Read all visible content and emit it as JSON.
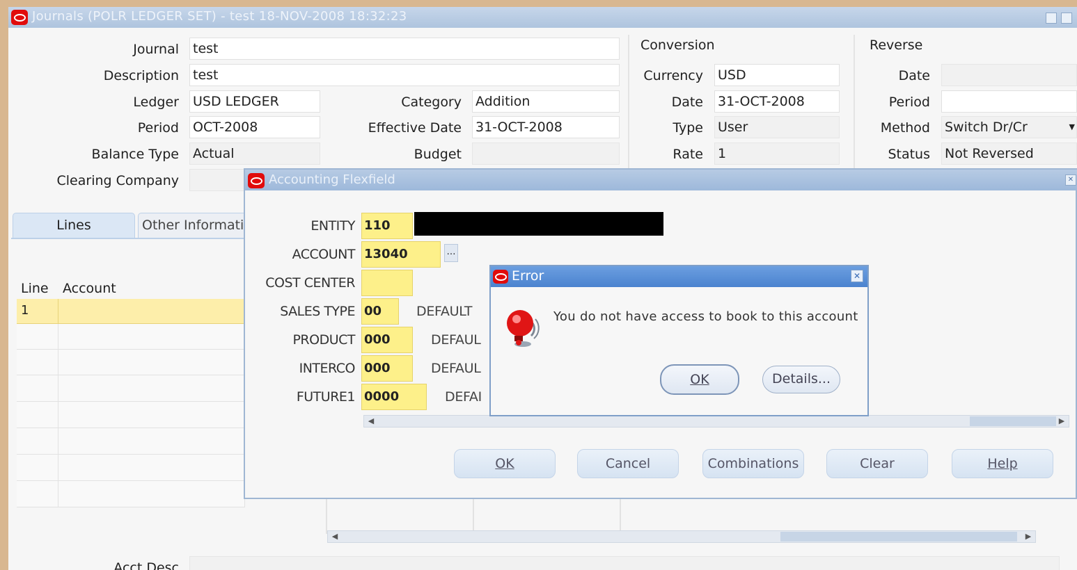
{
  "window": {
    "title": "Journals (POLR LEDGER SET) - test 18-NOV-2008 18:32:23"
  },
  "header": {
    "journal_label": "Journal",
    "journal_value": "test",
    "description_label": "Description",
    "description_value": "test",
    "ledger_label": "Ledger",
    "ledger_value": "USD LEDGER",
    "period_label": "Period",
    "period_value": "OCT-2008",
    "balance_type_label": "Balance Type",
    "balance_type_value": "Actual",
    "clearing_company_label": "Clearing Company",
    "category_label": "Category",
    "category_value": "Addition",
    "effective_date_label": "Effective Date",
    "effective_date_value": "31-OCT-2008",
    "budget_label": "Budget"
  },
  "conversion": {
    "group_label": "Conversion",
    "currency_label": "Currency",
    "currency_value": "USD",
    "date_label": "Date",
    "date_value": "31-OCT-2008",
    "type_label": "Type",
    "type_value": "User",
    "rate_label": "Rate",
    "rate_value": "1"
  },
  "reverse": {
    "group_label": "Reverse",
    "date_label": "Date",
    "period_label": "Period",
    "method_label": "Method",
    "method_value": "Switch Dr/Cr",
    "status_label": "Status",
    "status_value": "Not Reversed"
  },
  "tabs": {
    "lines": "Lines",
    "other": "Other Informatio"
  },
  "lines_grid": {
    "col_line": "Line",
    "col_account": "Account",
    "first_line_value": "1",
    "acct_desc_label": "Acct Desc"
  },
  "flexfield": {
    "title": "Accounting Flexfield",
    "segments": {
      "entity_label": "ENTITY",
      "entity_value": "110",
      "account_label": "ACCOUNT",
      "account_value": "13040",
      "cost_center_label": "COST CENTER",
      "sales_type_label": "SALES TYPE",
      "sales_type_value": "00",
      "sales_type_desc": "DEFAULT",
      "product_label": "PRODUCT",
      "product_value": "000",
      "product_desc": "DEFAUL",
      "interco_label": "INTERCO",
      "interco_value": "000",
      "interco_desc": "DEFAUL",
      "future1_label": "FUTURE1",
      "future1_value": "0000",
      "future1_desc": "DEFAI"
    },
    "buttons": {
      "ok": "OK",
      "cancel": "Cancel",
      "combinations": "Combinations",
      "clear": "Clear",
      "help": "Help"
    }
  },
  "error_dialog": {
    "title": "Error",
    "message": "You do not have access to book to this account",
    "ok": "OK",
    "details": "Details..."
  }
}
